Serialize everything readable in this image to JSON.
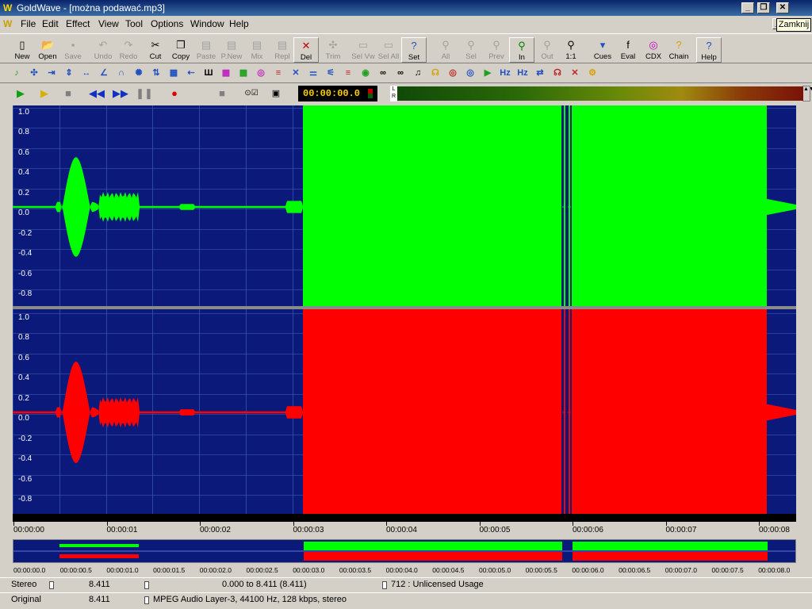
{
  "window": {
    "app": "GoldWave",
    "title": "GoldWave - [można podawać.mp3]"
  },
  "tooltip": "Zamknij",
  "menu": [
    "File",
    "Edit",
    "Effect",
    "View",
    "Tool",
    "Options",
    "Window",
    "Help"
  ],
  "toolbar": [
    {
      "label": "New",
      "icon": "new-file-icon",
      "enabled": true
    },
    {
      "label": "Open",
      "icon": "open-folder-icon",
      "enabled": true
    },
    {
      "label": "Save",
      "icon": "save-disk-icon",
      "enabled": false
    },
    {
      "label": "Undo",
      "icon": "undo-icon",
      "enabled": false
    },
    {
      "label": "Redo",
      "icon": "redo-icon",
      "enabled": false
    },
    {
      "label": "Cut",
      "icon": "scissors-icon",
      "enabled": true
    },
    {
      "label": "Copy",
      "icon": "copy-icon",
      "enabled": true
    },
    {
      "label": "Paste",
      "icon": "paste-icon",
      "enabled": false
    },
    {
      "label": "P.New",
      "icon": "paste-new-icon",
      "enabled": false
    },
    {
      "label": "Mix",
      "icon": "mix-icon",
      "enabled": false
    },
    {
      "label": "Repl",
      "icon": "replace-icon",
      "enabled": false
    },
    {
      "label": "Del",
      "icon": "delete-icon",
      "enabled": true
    },
    {
      "label": "Trim",
      "icon": "trim-icon",
      "enabled": false
    },
    {
      "label": "Sel Vw",
      "icon": "select-view-icon",
      "enabled": false
    },
    {
      "label": "Sel All",
      "icon": "select-all-icon",
      "enabled": false
    },
    {
      "label": "Set",
      "icon": "set-marker-icon",
      "enabled": true
    },
    {
      "label": "All",
      "icon": "zoom-all-icon",
      "enabled": false
    },
    {
      "label": "Sel",
      "icon": "zoom-selection-icon",
      "enabled": false
    },
    {
      "label": "Prev",
      "icon": "zoom-previous-icon",
      "enabled": false
    },
    {
      "label": "In",
      "icon": "zoom-in-icon",
      "enabled": true
    },
    {
      "label": "Out",
      "icon": "zoom-out-icon",
      "enabled": false
    },
    {
      "label": "1:1",
      "icon": "zoom-1-1-icon",
      "enabled": true
    },
    {
      "label": "Cues",
      "icon": "cues-icon",
      "enabled": true
    },
    {
      "label": "Eval",
      "icon": "function-eval-icon",
      "enabled": true
    },
    {
      "label": "CDX",
      "icon": "cd-extract-icon",
      "enabled": true
    },
    {
      "label": "Chain",
      "icon": "chain-icon",
      "enabled": true
    },
    {
      "label": "Help",
      "icon": "help-icon",
      "enabled": true
    }
  ],
  "transport": {
    "time": "00:00:00.0",
    "lr": "L R"
  },
  "waveform": {
    "y_labels_top": [
      "1.0",
      "0.8",
      "0.6",
      "0.4",
      "0.2",
      "0.0",
      "-0.2",
      "-0.4",
      "-0.6",
      "-0.8"
    ],
    "y_labels_bottom": [
      "1.0",
      "0.8",
      "0.6",
      "0.4",
      "0.2",
      "0.0",
      "-0.2",
      "-0.4",
      "-0.6",
      "-0.8"
    ],
    "left_color": "#00ff00",
    "right_color": "#ff0000",
    "background": "#0b1a7a"
  },
  "timeline": [
    "00:00:00",
    "00:00:01",
    "00:00:02",
    "00:00:03",
    "00:00:04",
    "00:00:05",
    "00:00:06",
    "00:00:07",
    "00:00:08"
  ],
  "overview_timeline": [
    "00:00:00.0",
    "00:00:00.5",
    "00:00:01.0",
    "00:00:01.5",
    "00:00:02.0",
    "00:00:02.5",
    "00:00:03.0",
    "00:00:03.5",
    "00:00:04.0",
    "00:00:04.5",
    "00:00:05.0",
    "00:00:05.5",
    "00:00:06.0",
    "00:00:06.5",
    "00:00:07.0",
    "00:00:07.5",
    "00:00:08.0"
  ],
  "status": {
    "row1": {
      "channels": "Stereo",
      "length": "8.411",
      "selection": "0.000 to 8.411 (8.411)",
      "license": "712 : Unlicensed Usage"
    },
    "row2": {
      "state": "Original",
      "length": "8.411",
      "format": "MPEG Audio Layer-3, 44100 Hz, 128 kbps, stereo"
    }
  }
}
